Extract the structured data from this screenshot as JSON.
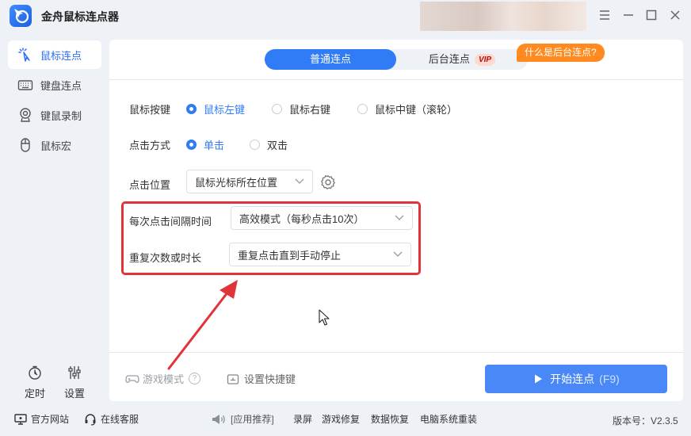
{
  "app": {
    "title": "金舟鼠标连点器",
    "accent_color": "#2f7cf6"
  },
  "window_controls": [
    "menu-icon",
    "minimize-icon",
    "maximize-icon",
    "close-icon"
  ],
  "sidebar": {
    "items": [
      {
        "label": "鼠标连点",
        "icon": "mouse-click-icon",
        "active": true
      },
      {
        "label": "键盘连点",
        "icon": "keyboard-icon",
        "active": false
      },
      {
        "label": "键鼠录制",
        "icon": "record-icon",
        "active": false
      },
      {
        "label": "鼠标宏",
        "icon": "mouse-icon",
        "active": false
      }
    ],
    "tools": [
      {
        "label": "定时",
        "icon": "timer-icon"
      },
      {
        "label": "设置",
        "icon": "sliders-icon"
      }
    ]
  },
  "tabs": {
    "normal": "普通连点",
    "background": "后台连点",
    "vip_badge": "VIP",
    "tip": "什么是后台连点?"
  },
  "form": {
    "mouse_button": {
      "label": "鼠标按键",
      "options": [
        "鼠标左键",
        "鼠标右键",
        "鼠标中键（滚轮）"
      ],
      "selected": 0
    },
    "click_type": {
      "label": "点击方式",
      "options": [
        "单击",
        "双击"
      ],
      "selected": 0
    },
    "click_position": {
      "label": "点击位置",
      "value": "鼠标光标所在位置"
    },
    "interval": {
      "label": "每次点击间隔时间",
      "value": "高效模式（每秒点击10次）"
    },
    "repeat": {
      "label": "重复次数或时长",
      "value": "重复点击直到手动停止"
    }
  },
  "bottom": {
    "game_mode": "游戏模式",
    "help": "?",
    "shortcut": "设置快捷键",
    "start": "开始连点",
    "start_key": "(F9)"
  },
  "footer": {
    "website": "官方网站",
    "service": "在线客服",
    "recommend": "[应用推荐]",
    "links": [
      "录屏",
      "游戏修复",
      "数据恢复",
      "电脑系统重装"
    ],
    "version": "版本号：V2.3.5"
  }
}
